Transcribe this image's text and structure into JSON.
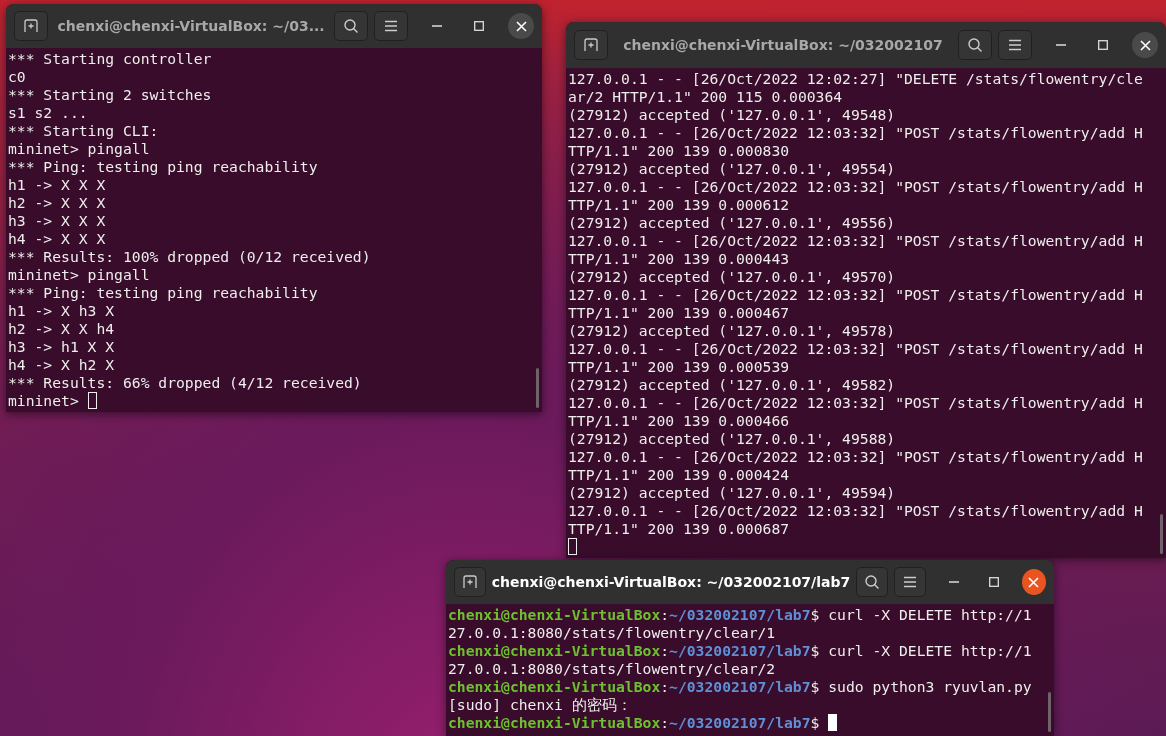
{
  "windows": [
    {
      "title": "chenxi@chenxi-VirtualBox: ~/03...",
      "active": false,
      "lines": [
        {
          "kind": "output",
          "text": "*** Starting controller"
        },
        {
          "kind": "output",
          "text": "c0"
        },
        {
          "kind": "output",
          "text": "*** Starting 2 switches"
        },
        {
          "kind": "output",
          "text": "s1 s2 ..."
        },
        {
          "kind": "output",
          "text": "*** Starting CLI:"
        },
        {
          "kind": "output",
          "text": "mininet> pingall"
        },
        {
          "kind": "output",
          "text": "*** Ping: testing ping reachability"
        },
        {
          "kind": "output",
          "text": "h1 -> X X X"
        },
        {
          "kind": "output",
          "text": "h2 -> X X X"
        },
        {
          "kind": "output",
          "text": "h3 -> X X X"
        },
        {
          "kind": "output",
          "text": "h4 -> X X X"
        },
        {
          "kind": "output",
          "text": "*** Results: 100% dropped (0/12 received)"
        },
        {
          "kind": "output",
          "text": "mininet> pingall"
        },
        {
          "kind": "output",
          "text": "*** Ping: testing ping reachability"
        },
        {
          "kind": "output",
          "text": "h1 -> X h3 X"
        },
        {
          "kind": "output",
          "text": "h2 -> X X h4"
        },
        {
          "kind": "output",
          "text": "h3 -> h1 X X"
        },
        {
          "kind": "output",
          "text": "h4 -> X h2 X"
        },
        {
          "kind": "output",
          "text": "*** Results: 66% dropped (4/12 received)"
        },
        {
          "kind": "output",
          "text": "mininet> "
        }
      ]
    },
    {
      "title": "chenxi@chenxi-VirtualBox: ~/032002107",
      "active": false,
      "lines": [
        {
          "kind": "output",
          "text": "127.0.0.1 - - [26/Oct/2022 12:02:27] \"DELETE /stats/flowentry/cle"
        },
        {
          "kind": "output",
          "text": "ar/2 HTTP/1.1\" 200 115 0.000364"
        },
        {
          "kind": "output",
          "text": "(27912) accepted ('127.0.0.1', 49548)"
        },
        {
          "kind": "output",
          "text": "127.0.0.1 - - [26/Oct/2022 12:03:32] \"POST /stats/flowentry/add H"
        },
        {
          "kind": "output",
          "text": "TTP/1.1\" 200 139 0.000830"
        },
        {
          "kind": "output",
          "text": "(27912) accepted ('127.0.0.1', 49554)"
        },
        {
          "kind": "output",
          "text": "127.0.0.1 - - [26/Oct/2022 12:03:32] \"POST /stats/flowentry/add H"
        },
        {
          "kind": "output",
          "text": "TTP/1.1\" 200 139 0.000612"
        },
        {
          "kind": "output",
          "text": "(27912) accepted ('127.0.0.1', 49556)"
        },
        {
          "kind": "output",
          "text": "127.0.0.1 - - [26/Oct/2022 12:03:32] \"POST /stats/flowentry/add H"
        },
        {
          "kind": "output",
          "text": "TTP/1.1\" 200 139 0.000443"
        },
        {
          "kind": "output",
          "text": "(27912) accepted ('127.0.0.1', 49570)"
        },
        {
          "kind": "output",
          "text": "127.0.0.1 - - [26/Oct/2022 12:03:32] \"POST /stats/flowentry/add H"
        },
        {
          "kind": "output",
          "text": "TTP/1.1\" 200 139 0.000467"
        },
        {
          "kind": "output",
          "text": "(27912) accepted ('127.0.0.1', 49578)"
        },
        {
          "kind": "output",
          "text": "127.0.0.1 - - [26/Oct/2022 12:03:32] \"POST /stats/flowentry/add H"
        },
        {
          "kind": "output",
          "text": "TTP/1.1\" 200 139 0.000539"
        },
        {
          "kind": "output",
          "text": "(27912) accepted ('127.0.0.1', 49582)"
        },
        {
          "kind": "output",
          "text": "127.0.0.1 - - [26/Oct/2022 12:03:32] \"POST /stats/flowentry/add H"
        },
        {
          "kind": "output",
          "text": "TTP/1.1\" 200 139 0.000466"
        },
        {
          "kind": "output",
          "text": "(27912) accepted ('127.0.0.1', 49588)"
        },
        {
          "kind": "output",
          "text": "127.0.0.1 - - [26/Oct/2022 12:03:32] \"POST /stats/flowentry/add H"
        },
        {
          "kind": "output",
          "text": "TTP/1.1\" 200 139 0.000424"
        },
        {
          "kind": "output",
          "text": "(27912) accepted ('127.0.0.1', 49594)"
        },
        {
          "kind": "output",
          "text": "127.0.0.1 - - [26/Oct/2022 12:03:32] \"POST /stats/flowentry/add H"
        },
        {
          "kind": "output",
          "text": "TTP/1.1\" 200 139 0.000687"
        },
        {
          "kind": "cursor_line"
        }
      ]
    },
    {
      "title": "chenxi@chenxi-VirtualBox: ~/032002107/lab7",
      "active": true,
      "lines": [
        {
          "kind": "prompt",
          "user": "chenxi@chenxi-VirtualBox",
          "separator": ":",
          "path": "~/032002107/lab7",
          "command": "$ curl -X DELETE http://1"
        },
        {
          "kind": "output",
          "text": "27.0.0.1:8080/stats/flowentry/clear/1"
        },
        {
          "kind": "prompt",
          "user": "chenxi@chenxi-VirtualBox",
          "separator": ":",
          "path": "~/032002107/lab7",
          "command": "$ curl -X DELETE http://1"
        },
        {
          "kind": "output",
          "text": "27.0.0.1:8080/stats/flowentry/clear/2"
        },
        {
          "kind": "prompt",
          "user": "chenxi@chenxi-VirtualBox",
          "separator": ":",
          "path": "~/032002107/lab7",
          "command": "$ sudo python3 ryuvlan.py"
        },
        {
          "kind": "output",
          "text": "[sudo] chenxi 的密码："
        },
        {
          "kind": "prompt",
          "user": "chenxi@chenxi-VirtualBox",
          "separator": ":",
          "path": "~/032002107/lab7",
          "command": "$ "
        }
      ]
    }
  ]
}
